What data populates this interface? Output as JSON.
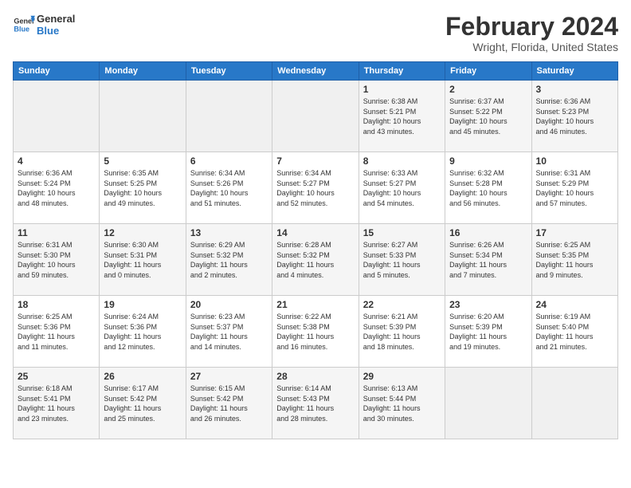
{
  "logo": {
    "line1": "General",
    "line2": "Blue"
  },
  "title": "February 2024",
  "location": "Wright, Florida, United States",
  "days_of_week": [
    "Sunday",
    "Monday",
    "Tuesday",
    "Wednesday",
    "Thursday",
    "Friday",
    "Saturday"
  ],
  "weeks": [
    [
      {
        "day": "",
        "info": ""
      },
      {
        "day": "",
        "info": ""
      },
      {
        "day": "",
        "info": ""
      },
      {
        "day": "",
        "info": ""
      },
      {
        "day": "1",
        "info": "Sunrise: 6:38 AM\nSunset: 5:21 PM\nDaylight: 10 hours\nand 43 minutes."
      },
      {
        "day": "2",
        "info": "Sunrise: 6:37 AM\nSunset: 5:22 PM\nDaylight: 10 hours\nand 45 minutes."
      },
      {
        "day": "3",
        "info": "Sunrise: 6:36 AM\nSunset: 5:23 PM\nDaylight: 10 hours\nand 46 minutes."
      }
    ],
    [
      {
        "day": "4",
        "info": "Sunrise: 6:36 AM\nSunset: 5:24 PM\nDaylight: 10 hours\nand 48 minutes."
      },
      {
        "day": "5",
        "info": "Sunrise: 6:35 AM\nSunset: 5:25 PM\nDaylight: 10 hours\nand 49 minutes."
      },
      {
        "day": "6",
        "info": "Sunrise: 6:34 AM\nSunset: 5:26 PM\nDaylight: 10 hours\nand 51 minutes."
      },
      {
        "day": "7",
        "info": "Sunrise: 6:34 AM\nSunset: 5:27 PM\nDaylight: 10 hours\nand 52 minutes."
      },
      {
        "day": "8",
        "info": "Sunrise: 6:33 AM\nSunset: 5:27 PM\nDaylight: 10 hours\nand 54 minutes."
      },
      {
        "day": "9",
        "info": "Sunrise: 6:32 AM\nSunset: 5:28 PM\nDaylight: 10 hours\nand 56 minutes."
      },
      {
        "day": "10",
        "info": "Sunrise: 6:31 AM\nSunset: 5:29 PM\nDaylight: 10 hours\nand 57 minutes."
      }
    ],
    [
      {
        "day": "11",
        "info": "Sunrise: 6:31 AM\nSunset: 5:30 PM\nDaylight: 10 hours\nand 59 minutes."
      },
      {
        "day": "12",
        "info": "Sunrise: 6:30 AM\nSunset: 5:31 PM\nDaylight: 11 hours\nand 0 minutes."
      },
      {
        "day": "13",
        "info": "Sunrise: 6:29 AM\nSunset: 5:32 PM\nDaylight: 11 hours\nand 2 minutes."
      },
      {
        "day": "14",
        "info": "Sunrise: 6:28 AM\nSunset: 5:32 PM\nDaylight: 11 hours\nand 4 minutes."
      },
      {
        "day": "15",
        "info": "Sunrise: 6:27 AM\nSunset: 5:33 PM\nDaylight: 11 hours\nand 5 minutes."
      },
      {
        "day": "16",
        "info": "Sunrise: 6:26 AM\nSunset: 5:34 PM\nDaylight: 11 hours\nand 7 minutes."
      },
      {
        "day": "17",
        "info": "Sunrise: 6:25 AM\nSunset: 5:35 PM\nDaylight: 11 hours\nand 9 minutes."
      }
    ],
    [
      {
        "day": "18",
        "info": "Sunrise: 6:25 AM\nSunset: 5:36 PM\nDaylight: 11 hours\nand 11 minutes."
      },
      {
        "day": "19",
        "info": "Sunrise: 6:24 AM\nSunset: 5:36 PM\nDaylight: 11 hours\nand 12 minutes."
      },
      {
        "day": "20",
        "info": "Sunrise: 6:23 AM\nSunset: 5:37 PM\nDaylight: 11 hours\nand 14 minutes."
      },
      {
        "day": "21",
        "info": "Sunrise: 6:22 AM\nSunset: 5:38 PM\nDaylight: 11 hours\nand 16 minutes."
      },
      {
        "day": "22",
        "info": "Sunrise: 6:21 AM\nSunset: 5:39 PM\nDaylight: 11 hours\nand 18 minutes."
      },
      {
        "day": "23",
        "info": "Sunrise: 6:20 AM\nSunset: 5:39 PM\nDaylight: 11 hours\nand 19 minutes."
      },
      {
        "day": "24",
        "info": "Sunrise: 6:19 AM\nSunset: 5:40 PM\nDaylight: 11 hours\nand 21 minutes."
      }
    ],
    [
      {
        "day": "25",
        "info": "Sunrise: 6:18 AM\nSunset: 5:41 PM\nDaylight: 11 hours\nand 23 minutes."
      },
      {
        "day": "26",
        "info": "Sunrise: 6:17 AM\nSunset: 5:42 PM\nDaylight: 11 hours\nand 25 minutes."
      },
      {
        "day": "27",
        "info": "Sunrise: 6:15 AM\nSunset: 5:42 PM\nDaylight: 11 hours\nand 26 minutes."
      },
      {
        "day": "28",
        "info": "Sunrise: 6:14 AM\nSunset: 5:43 PM\nDaylight: 11 hours\nand 28 minutes."
      },
      {
        "day": "29",
        "info": "Sunrise: 6:13 AM\nSunset: 5:44 PM\nDaylight: 11 hours\nand 30 minutes."
      },
      {
        "day": "",
        "info": ""
      },
      {
        "day": "",
        "info": ""
      }
    ]
  ]
}
